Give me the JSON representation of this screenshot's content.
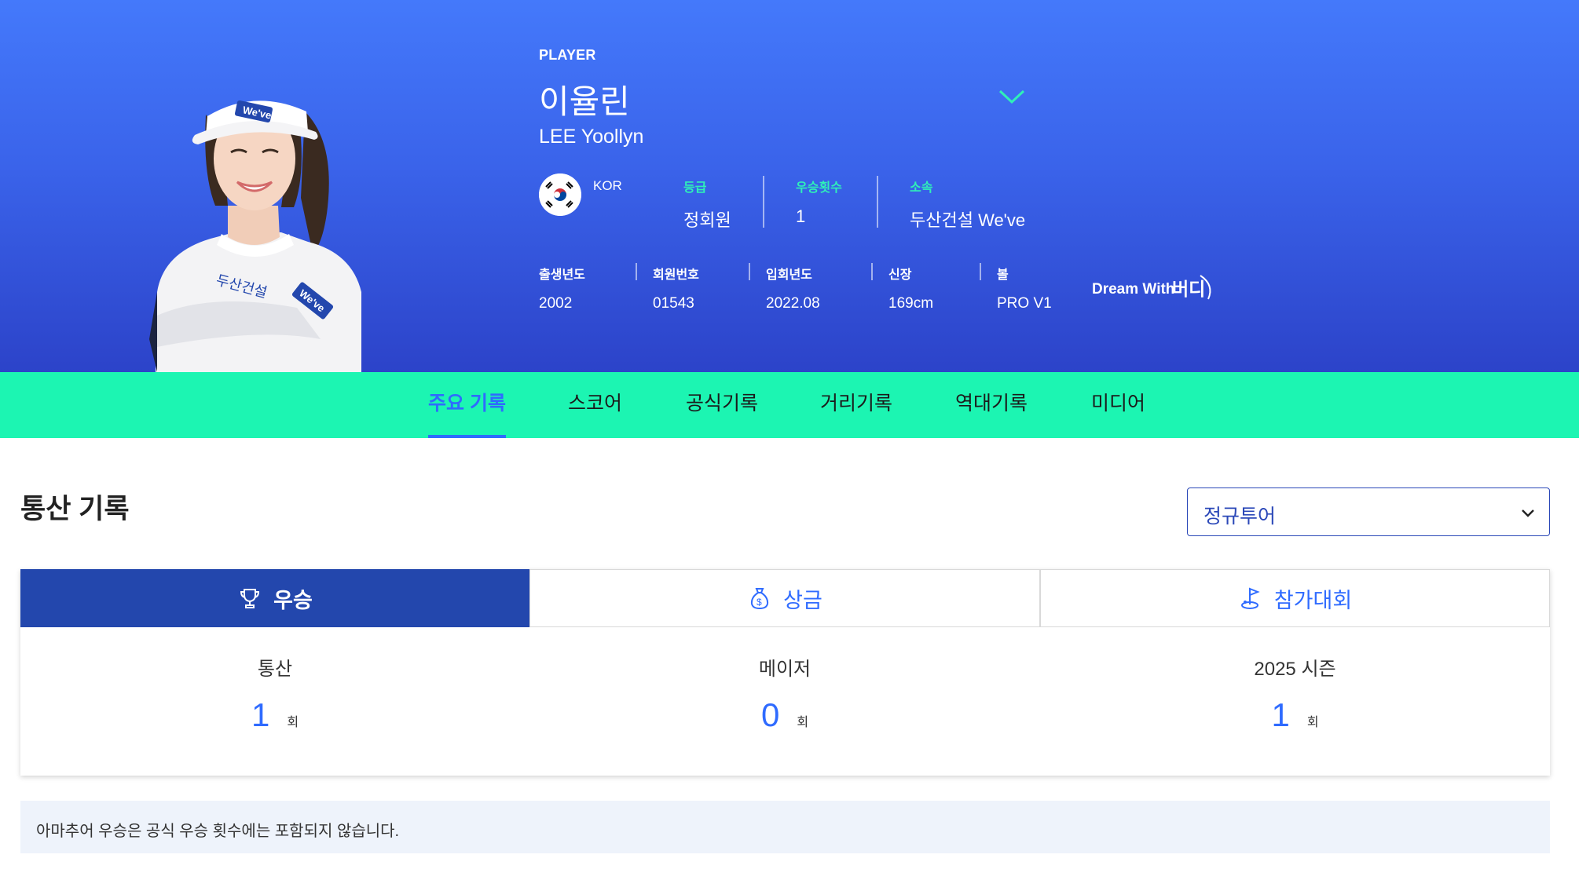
{
  "player": {
    "label": "PLAYER",
    "name_ko": "이율린",
    "name_en": "LEE Yoollyn",
    "country": "KOR",
    "grade_label": "등급",
    "grade_value": "정회원",
    "wins_label": "우승횟수",
    "wins_value": "1",
    "affiliation_label": "소속",
    "affiliation_value": "두산건설 We've",
    "details": [
      {
        "label": "출생년도",
        "value": "2002"
      },
      {
        "label": "회원번호",
        "value": "01543"
      },
      {
        "label": "입회년도",
        "value": "2022.08"
      },
      {
        "label": "신장",
        "value": "169cm"
      },
      {
        "label": "볼",
        "value": "PRO V1"
      }
    ],
    "sponsor_logo": "Dream With 버디",
    "cap_brand": "We've",
    "jacket_text": "두산건설"
  },
  "tabs": [
    "주요 기록",
    "스코어",
    "공식기록",
    "거리기록",
    "역대기록",
    "미디어"
  ],
  "section": {
    "title": "통산 기록",
    "tour_select": "정규투어"
  },
  "record_tabs": [
    {
      "label": "우승",
      "icon": "trophy-icon",
      "active": true
    },
    {
      "label": "상금",
      "icon": "money-bag-icon",
      "active": false
    },
    {
      "label": "참가대회",
      "icon": "golf-flag-icon",
      "active": false
    }
  ],
  "metrics": [
    {
      "label": "통산",
      "value": "1",
      "unit": "회"
    },
    {
      "label": "메이저",
      "value": "0",
      "unit": "회"
    },
    {
      "label": "2025 시즌",
      "value": "1",
      "unit": "회"
    }
  ],
  "notice": "아마추어 우승은 공식 우승 횟수에는 포함되지 않습니다.",
  "colors": {
    "hero_top": "#4479fb",
    "hero_bottom": "#2c43c9",
    "tab_bar": "#1cf5b2",
    "accent_blue": "#2f6bff",
    "mint_label": "#2ff0b8",
    "active_record_tab": "#2347ad"
  }
}
